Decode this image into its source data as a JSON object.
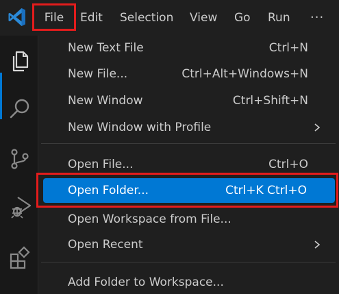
{
  "menubar": {
    "logo_icon": "vscode-logo-icon",
    "items": [
      "File",
      "Edit",
      "Selection",
      "View",
      "Go",
      "Run",
      "···"
    ]
  },
  "activity_bar": {
    "icons": [
      "explorer-icon",
      "search-icon",
      "source-control-icon",
      "run-debug-icon",
      "extensions-icon"
    ]
  },
  "file_menu": {
    "items": [
      {
        "label": "New Text File",
        "shortcut": "Ctrl+N"
      },
      {
        "label": "New File...",
        "shortcut": "Ctrl+Alt+Windows+N"
      },
      {
        "label": "New Window",
        "shortcut": "Ctrl+Shift+N"
      },
      {
        "label": "New Window with Profile",
        "shortcut": "",
        "submenu": true
      },
      {
        "label": "Open File...",
        "shortcut": "Ctrl+O"
      },
      {
        "label": "Open Folder...",
        "shortcut": "Ctrl+K Ctrl+O",
        "selected": true
      },
      {
        "label": "Open Workspace from File...",
        "shortcut": ""
      },
      {
        "label": "Open Recent",
        "shortcut": "",
        "submenu": true
      },
      {
        "label": "Add Folder to Workspace...",
        "shortcut": ""
      }
    ]
  },
  "colors": {
    "accent": "#0078d4",
    "highlight_border": "#e31c1c",
    "background": "#1f1f1f",
    "text": "#cccccc"
  }
}
